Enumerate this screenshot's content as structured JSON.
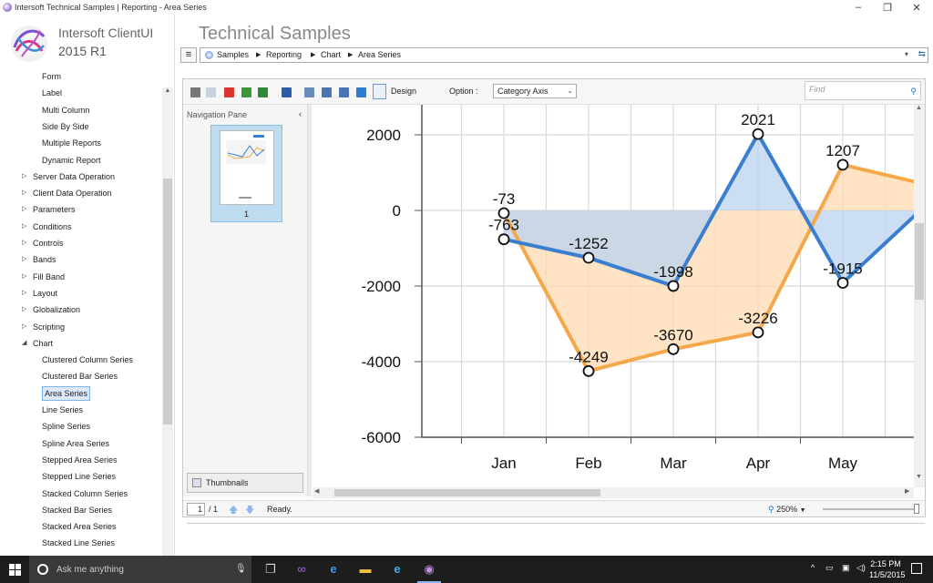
{
  "window": {
    "title": "Intersoft Technical Samples | Reporting - Area Series",
    "controls": [
      "–",
      "❐",
      "✕"
    ]
  },
  "brand": {
    "name": "Intersoft ClientUI",
    "version": "2015 R1"
  },
  "page_title": "Technical Samples",
  "breadcrumb": [
    "Samples",
    "Reporting",
    "Chart",
    "Area Series"
  ],
  "tree": [
    {
      "label": "Form",
      "level": 2
    },
    {
      "label": "Label",
      "level": 2
    },
    {
      "label": "Multi Column",
      "level": 2
    },
    {
      "label": "Side By Side",
      "level": 2
    },
    {
      "label": "Multiple Reports",
      "level": 2
    },
    {
      "label": "Dynamic Report",
      "level": 2
    },
    {
      "label": "Server Data Operation",
      "level": 1,
      "arrow": "▷"
    },
    {
      "label": "Client Data Operation",
      "level": 1,
      "arrow": "▷"
    },
    {
      "label": "Parameters",
      "level": 1,
      "arrow": "▷"
    },
    {
      "label": "Conditions",
      "level": 1,
      "arrow": "▷"
    },
    {
      "label": "Controls",
      "level": 1,
      "arrow": "▷"
    },
    {
      "label": "Bands",
      "level": 1,
      "arrow": "▷"
    },
    {
      "label": "Fill Band",
      "level": 1,
      "arrow": "▷"
    },
    {
      "label": "Layout",
      "level": 1,
      "arrow": "▷"
    },
    {
      "label": "Globalization",
      "level": 1,
      "arrow": "▷"
    },
    {
      "label": "Scripting",
      "level": 1,
      "arrow": "▷"
    },
    {
      "label": "Chart",
      "level": 1,
      "arrow": "◢"
    },
    {
      "label": "Clustered Column Series",
      "level": 2
    },
    {
      "label": "Clustered Bar Series",
      "level": 2
    },
    {
      "label": "Area Series",
      "level": 2,
      "selected": true
    },
    {
      "label": "Line Series",
      "level": 2
    },
    {
      "label": "Spline Series",
      "level": 2
    },
    {
      "label": "Spline Area Series",
      "level": 2
    },
    {
      "label": "Stepped Area Series",
      "level": 2
    },
    {
      "label": "Stepped Line Series",
      "level": 2
    },
    {
      "label": "Stacked Column Series",
      "level": 2
    },
    {
      "label": "Stacked Bar Series",
      "level": 2
    },
    {
      "label": "Stacked Area Series",
      "level": 2
    },
    {
      "label": "Stacked Line Series",
      "level": 2
    }
  ],
  "toolbar": {
    "icons": [
      "print-icon",
      "copy-icon",
      "pdf-icon",
      "export-icon",
      "excel-icon",
      "save-icon",
      "page-setup-icon",
      "single-page-icon",
      "two-page-icon",
      "fit-icon",
      "fullscreen-icon"
    ],
    "design_label": "Design",
    "option_label": "Option :",
    "option_value": "Category Axis",
    "find_placeholder": "Find"
  },
  "nav_pane": {
    "title": "Navigation Pane",
    "page_number": "1",
    "thumbnails_label": "Thumbnails"
  },
  "statusbar": {
    "page_current": "1",
    "page_total": "/ 1",
    "status": "Ready.",
    "zoom": "250%"
  },
  "colors": {
    "series_orange": "#f5a84a",
    "series_blue": "#3a7fcf",
    "fill_orange": "#fdd9b0",
    "fill_blue": "#b9d3ef",
    "fill_overlap": "#d7c5b4",
    "selection": "#dbe9fa"
  },
  "chart_data": {
    "type": "area",
    "categories": [
      "Jan",
      "Feb",
      "Mar",
      "Apr",
      "May"
    ],
    "series": [
      {
        "values": [
          -73,
          -4249,
          -3670,
          -3226,
          1207
        ],
        "color": "#f5a84a"
      },
      {
        "values": [
          -763,
          -1252,
          -1998,
          2021,
          -1915
        ],
        "color": "#3a7fcf"
      }
    ],
    "ylim": [
      -6000,
      2000
    ],
    "yticks": [
      2000,
      0,
      -2000,
      -4000,
      -6000
    ],
    "data_labels": [
      {
        "series": 0,
        "index": 0,
        "text": "-73"
      },
      {
        "series": 0,
        "index": 1,
        "text": "-4249"
      },
      {
        "series": 0,
        "index": 2,
        "text": "-3670"
      },
      {
        "series": 0,
        "index": 3,
        "text": "-3226"
      },
      {
        "series": 0,
        "index": 4,
        "text": "1207"
      },
      {
        "series": 1,
        "index": 0,
        "text": "-763"
      },
      {
        "series": 1,
        "index": 1,
        "text": "-1252"
      },
      {
        "series": 1,
        "index": 2,
        "text": "-1998"
      },
      {
        "series": 1,
        "index": 3,
        "text": "2021"
      },
      {
        "series": 1,
        "index": 4,
        "text": "-1915"
      }
    ],
    "grid": true,
    "xlabel": "",
    "ylabel": ""
  },
  "taskbar": {
    "search_placeholder": "Ask me anything",
    "time": "2:15 PM",
    "date": "11/5/2015"
  }
}
